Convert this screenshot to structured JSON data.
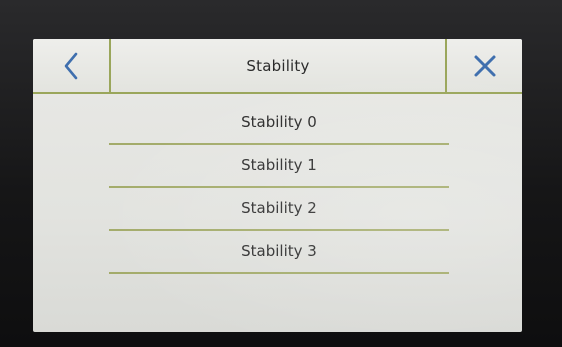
{
  "header": {
    "title": "Stability",
    "back_icon": "chevron-left-icon",
    "close_icon": "close-icon"
  },
  "options": [
    {
      "label": "Stability 0"
    },
    {
      "label": "Stability 1"
    },
    {
      "label": "Stability 2"
    },
    {
      "label": "Stability 3"
    }
  ],
  "colors": {
    "accent": "#9aa65b",
    "icon_blue": "#3f6fae",
    "screen_bg": "#e4e5e1",
    "text": "#2a2a2a"
  }
}
